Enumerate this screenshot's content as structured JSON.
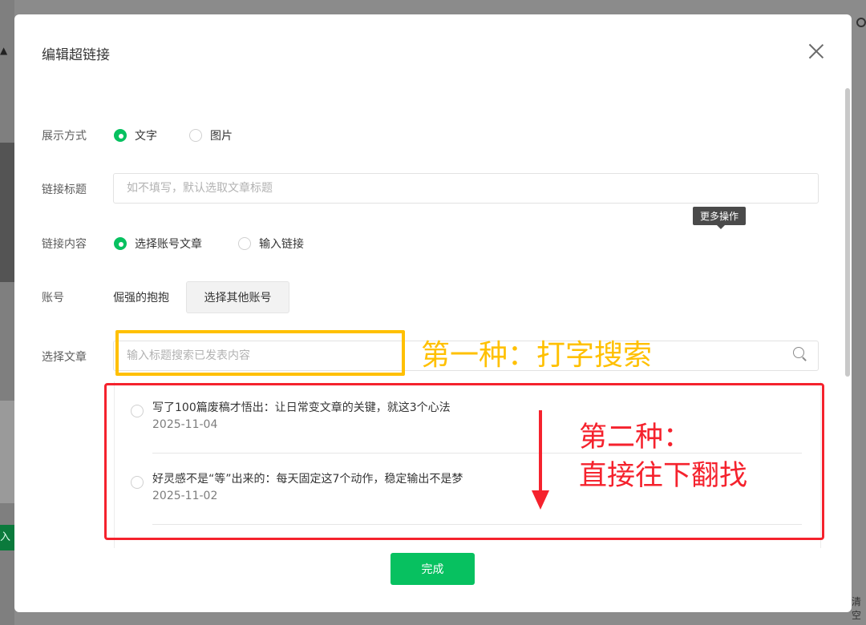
{
  "dialog": {
    "title": "编辑超链接",
    "close_icon": "close-icon"
  },
  "display_mode": {
    "label": "展示方式",
    "options": [
      {
        "label": "文字",
        "selected": true
      },
      {
        "label": "图片",
        "selected": false
      }
    ]
  },
  "link_title": {
    "label": "链接标题",
    "value": "",
    "placeholder": "如不填写，默认选取文章标题"
  },
  "tooltip": "更多操作",
  "link_content": {
    "label": "链接内容",
    "options": [
      {
        "label": "选择账号文章",
        "selected": true
      },
      {
        "label": "输入链接",
        "selected": false
      }
    ]
  },
  "account": {
    "label": "账号",
    "name": "倔强的抱抱",
    "switch_button": "选择其他账号"
  },
  "select_article": {
    "label": "选择文章",
    "search_value": "",
    "search_placeholder": "输入标题搜索已发表内容",
    "search_icon": "search-icon"
  },
  "articles": [
    {
      "title": "写了100篇废稿才悟出：让日常变文章的关键，就这3个心法",
      "date": "2025-11-04",
      "selected": false
    },
    {
      "title": "好灵感不是“等”出来的：每天固定这7个动作，稳定输出不是梦",
      "date": "2025-11-02",
      "selected": false
    }
  ],
  "done_button": "完成",
  "annotations": {
    "method_one": "第一种：打字搜索",
    "method_two_line1": "第二种：",
    "method_two_line2": "直接往下翻找",
    "yellow": "#ffc000",
    "red": "#f5222d"
  },
  "backdrop": {
    "right_edge_text": "清空",
    "left_edge_button": "入"
  },
  "colors": {
    "accent": "#07c160"
  }
}
